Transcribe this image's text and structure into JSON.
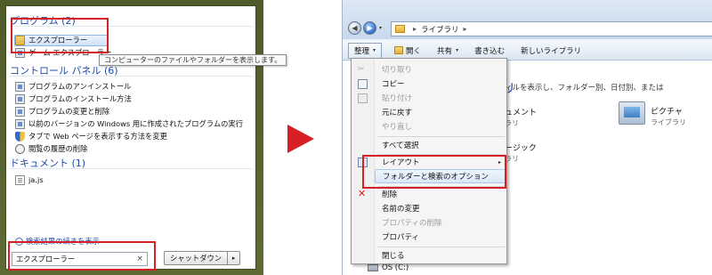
{
  "start_menu": {
    "programs_header": "プログラム (2)",
    "programs": [
      {
        "label": "エクスプローラー",
        "icon": "folder-icon"
      },
      {
        "label": "ゲーム エクスプローラー",
        "icon": "game-icon"
      }
    ],
    "tooltip": "コンピューターのファイルやフォルダーを表示します。",
    "control_panel_header": "コントロール パネル (6)",
    "control_panel": [
      "プログラムのアンインストール",
      "プログラムのインストール方法",
      "プログラムの変更と削除",
      "以前のバージョンの Windows 用に作成されたプログラムの実行",
      "タブで Web ページを表示する方法を変更",
      "閲覧の履歴の削除"
    ],
    "documents_header": "ドキュメント (1)",
    "documents": [
      "ja.js"
    ],
    "more_results": "検索結果の続きを表示",
    "search_value": "エクスプローラー",
    "search_clear": "×",
    "shutdown_label": "シャットダウン",
    "shutdown_arrow": "▸"
  },
  "explorer": {
    "nav_back": "◀",
    "nav_forward": "▶",
    "nav_dropdown": "▾",
    "address_sep": "▸",
    "address_label": "ライブラリ",
    "address_tail": "▸",
    "commands": {
      "organize": "整理",
      "open": "開く",
      "share": "共有",
      "burn": "書き込む",
      "new_library": "新しいライブラリ"
    },
    "content": {
      "fragment_blue": "リ",
      "description_fragment": "ィルを表示し、フォルダー別、日付別、または",
      "fragment_1": "ュメント",
      "fragment_1_sub": "ラリ",
      "fragment_2": "ージック",
      "fragment_2_sub": "ラリ",
      "pictures_name": "ピクチャ",
      "pictures_sub": "ライブラリ",
      "drive_label": "OS (C:)"
    },
    "menu": [
      {
        "label": "切り取り",
        "disabled": true,
        "icon": "scissors-icon"
      },
      {
        "label": "コピー",
        "disabled": false,
        "icon": "copy-icon"
      },
      {
        "label": "貼り付け",
        "disabled": true,
        "icon": "paste-icon"
      },
      {
        "label": "元に戻す",
        "disabled": false
      },
      {
        "label": "やり直し",
        "disabled": true
      },
      {
        "label": "すべて選択",
        "disabled": false
      },
      {
        "label": "レイアウト",
        "disabled": false,
        "submenu": true
      },
      {
        "label": "フォルダーと検索のオプション",
        "disabled": false,
        "highlighted": true
      },
      {
        "label": "削除",
        "disabled": false,
        "icon": "delete-icon"
      },
      {
        "label": "名前の変更",
        "disabled": false
      },
      {
        "label": "プロパティの削除",
        "disabled": true
      },
      {
        "label": "プロパティ",
        "disabled": false
      },
      {
        "label": "閉じる",
        "disabled": false
      }
    ],
    "submenu_arrow": "▸"
  },
  "colors": {
    "highlight_box": "#d81f26",
    "arrow": "#d81f26",
    "link_blue": "#1e4aa8"
  }
}
